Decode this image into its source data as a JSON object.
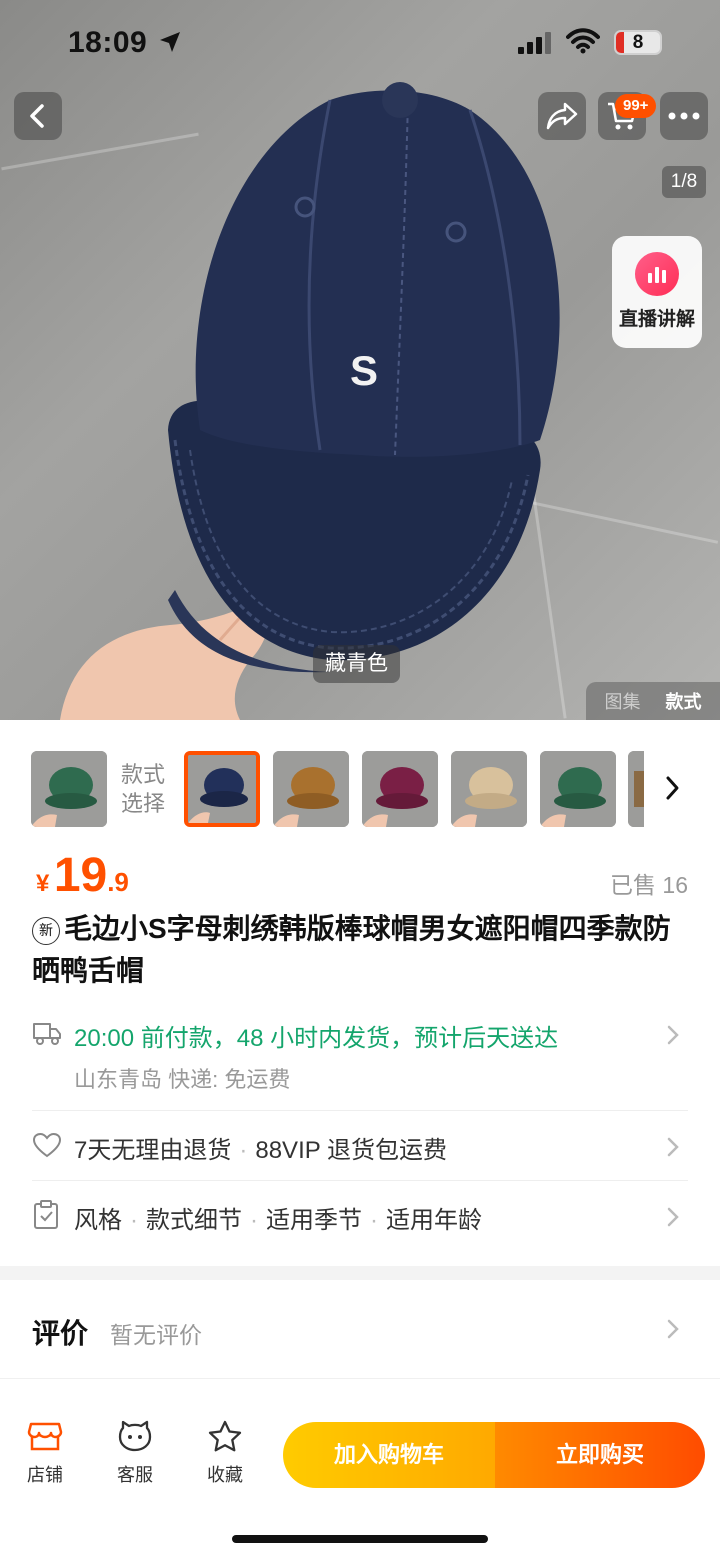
{
  "status_bar": {
    "time": "18:09",
    "battery": "8"
  },
  "header": {
    "cart_badge": "99+",
    "page_indicator": "1/8"
  },
  "live": {
    "label": "直播讲解"
  },
  "hero": {
    "color_tag": "藏青色",
    "view_tabs": [
      "图集",
      "款式"
    ],
    "active_view": "款式"
  },
  "styles": {
    "label": "款式选择",
    "thumbs": [
      {
        "color": "#2f6b4f"
      },
      {
        "color": "#22305a",
        "selected": true
      },
      {
        "color": "#a9712e"
      },
      {
        "color": "#7a1f45"
      },
      {
        "color": "#d8c19c"
      },
      {
        "color": "#2f6b4f"
      }
    ]
  },
  "product": {
    "price_symbol": "¥",
    "price_int": "19",
    "price_dec": ".9",
    "sold": "已售 16",
    "new_badge": "新",
    "title": "毛边小S字母刺绣韩版棒球帽男女遮阳帽四季款防晒鸭舌帽"
  },
  "shipping": {
    "line1": "20:00 前付款，48 小时内发货，预计后天送达",
    "line2": "山东青岛  快递: 免运费"
  },
  "returns": {
    "item1": "7天无理由退货",
    "item2": "88VIP 退货包运费"
  },
  "params": {
    "items": [
      "风格",
      "款式细节",
      "适用季节",
      "适用年龄"
    ]
  },
  "reviews": {
    "title": "评价",
    "empty_text": "暂无评价"
  },
  "bottom": {
    "shop": "店铺",
    "service": "客服",
    "favorite": "收藏",
    "add_cart": "加入购物车",
    "buy_now": "立即购买"
  },
  "colors": {
    "accent": "#ff5000",
    "green": "#14a56c"
  }
}
